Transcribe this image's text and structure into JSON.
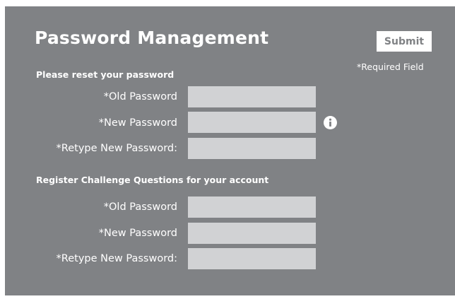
{
  "header": {
    "title": "Password Management",
    "submit_label": "Submit",
    "required_note": "*Required Field"
  },
  "reset_section": {
    "heading": "Please reset your password",
    "fields": [
      {
        "label": "*Old Password",
        "value": ""
      },
      {
        "label": "*New Password",
        "value": ""
      },
      {
        "label": "*Retype New Password:",
        "value": ""
      }
    ],
    "info_icon": "info-icon"
  },
  "challenge_section": {
    "heading": "Register Challenge Questions for your account",
    "fields": [
      {
        "label": "*Old Password",
        "value": ""
      },
      {
        "label": "*New Password",
        "value": ""
      },
      {
        "label": "*Retype New Password:",
        "value": ""
      }
    ]
  },
  "colors": {
    "panel_background": "#808285",
    "input_background": "#d1d2d4",
    "text": "#ffffff"
  }
}
